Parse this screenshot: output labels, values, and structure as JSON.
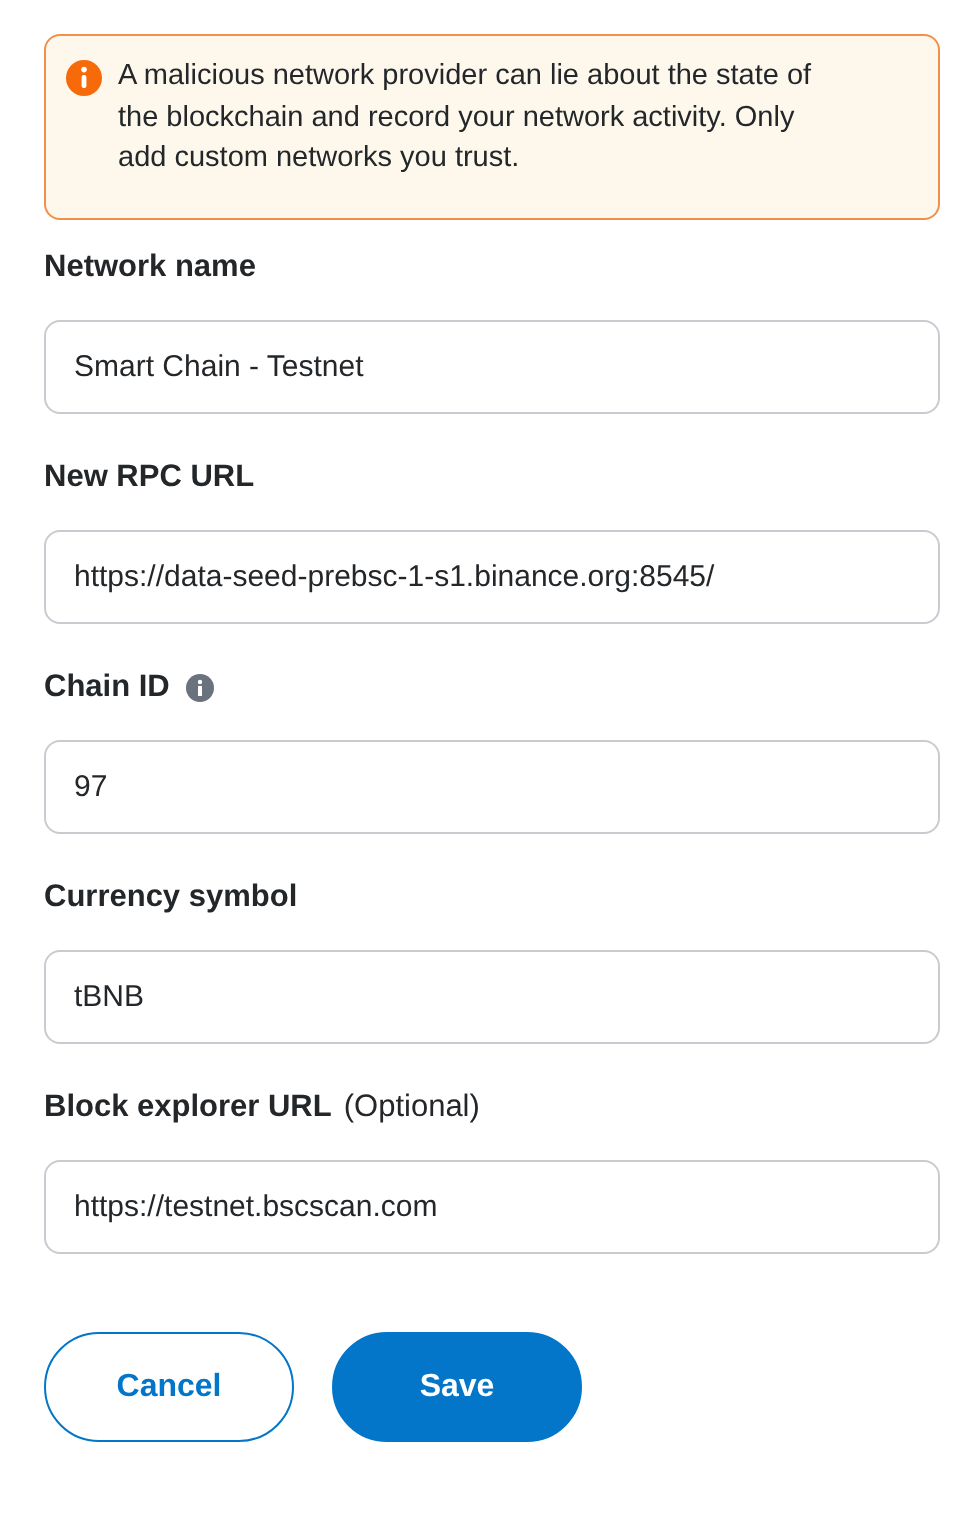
{
  "warning": {
    "text": "A malicious network provider can lie about the state of the blockchain and record your network activity. Only add custom networks you trust."
  },
  "fields": [
    {
      "label": "Network name",
      "info": false,
      "value": "Smart Chain - Testnet"
    },
    {
      "label": "New RPC URL",
      "info": false,
      "value": "https://data-seed-prebsc-1-s1.binance.org:8545/"
    },
    {
      "label": "Chain ID",
      "info": true,
      "value": "97"
    },
    {
      "label": "Currency symbol",
      "info": false,
      "value": "tBNB"
    },
    {
      "label": "Block explorer URL",
      "info": false,
      "hint": "(Optional)",
      "value": "https://testnet.bscscan.com"
    }
  ],
  "buttons": [
    {
      "label": "Cancel",
      "kind": "secondary"
    },
    {
      "label": "Save",
      "kind": "primary"
    }
  ]
}
